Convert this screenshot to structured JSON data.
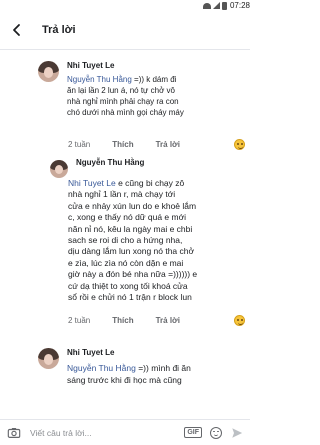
{
  "status_bar": {
    "time": "07:28"
  },
  "header": {
    "title": "Trả lời"
  },
  "comments": [
    {
      "author": "Nhi Tuyet Le",
      "mention": "Nguyễn Thu Hằng",
      "lines": [
        " =)) k dám đi",
        "ăn lại lần 2 lun á, nó tự chở vô",
        "nhà nghỉ mình phải chạy ra con",
        "chó dưới nhà mình gọi cháy máy"
      ],
      "time": "2 tuần",
      "like_label": "Thích",
      "reply_label": "Trả lời"
    },
    {
      "author": "Nguyễn Thu Hằng",
      "mention": "Nhi Tuyet Le",
      "lines": [
        " e cũng bi chạy zô",
        "nhà nghỉ 1 lần r, mà chạy tới",
        "cửa e nhảy xún lun do e khoẻ lắm",
        "c, xong e thấy nó dữ quá e mới",
        "năn nỉ nó, kêu la ngày mai e chbi",
        "sach se roi di cho a hứng nha,",
        "dịu dàng lắm lun xong nó tha chở",
        "e zìa, lúc zìa nó còn dặn e mai",
        "giờ này a đón bé nha nữa =)))))) e",
        "cứ dạ thiệt to xong tối khoá cửa",
        "sổ rồi e chửi nó 1 trận r block lun"
      ],
      "time": "2 tuần",
      "like_label": "Thích",
      "reply_label": "Trả lời"
    },
    {
      "author": "Nhi Tuyet Le",
      "mention": "Nguyễn Thu Hằng",
      "lines": [
        " =)) mình đi ăn",
        "sáng trước khi đi học mà cũng"
      ]
    }
  ],
  "input": {
    "placeholder": "Viết câu trả lời...",
    "gif_label": "GIF"
  },
  "icons": {
    "back": "arrow-left-icon",
    "camera": "camera-icon",
    "gif": "gif-icon",
    "emoji": "emoji-icon",
    "send": "send-icon",
    "reaction": "haha-reaction-icon"
  }
}
